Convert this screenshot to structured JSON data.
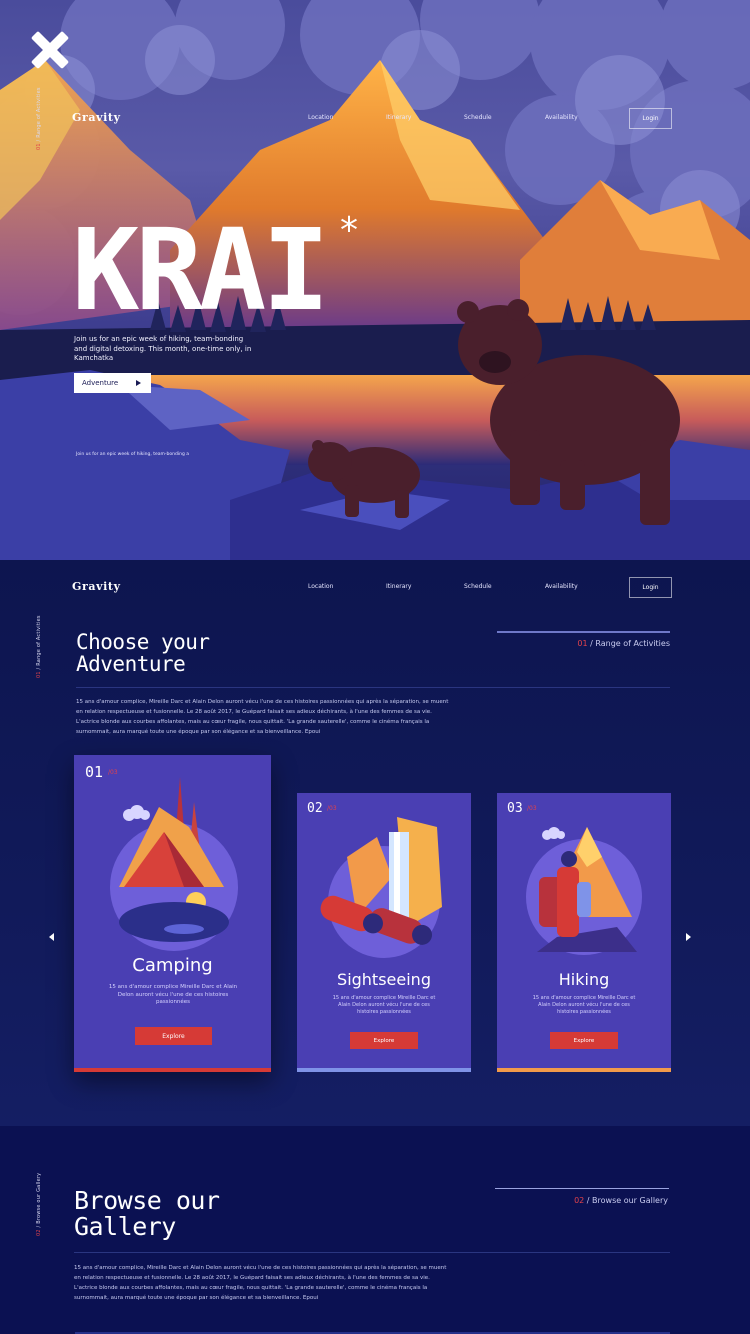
{
  "hero": {
    "brand": "Gravity",
    "nav": [
      "Location",
      "Itinerary",
      "Schedule",
      "Availability"
    ],
    "login": "Login",
    "side_label_num": "01",
    "side_label_text": "/ Range of Activities",
    "title": "KRAI",
    "asterisk": "*",
    "description": "Join us for an epic week of hiking, team-bonding and digital detoxing. This month, one-time only, in Kamchatka",
    "cta": "Adventure",
    "small_caption": "Join us for an epic week of hiking, team-bonding a"
  },
  "section2": {
    "brand": "Gravity",
    "nav": [
      "Location",
      "Itinerary",
      "Schedule",
      "Availability"
    ],
    "login": "Login",
    "side_label_num": "01",
    "side_label_text": "/ Range of Activities",
    "title_line1": "Choose your",
    "title_line2": "Adventure",
    "tag_num": "01",
    "tag_text": "/ Range of Activities",
    "paragraph": "15 ans d'amour complice, Mireille Darc et Alain Delon auront vécu l'une de ces histoires passionnées qui après la séparation, se muent en relation respectueuse et fusionnelle. Le 28 août 2017, le Guépard faisait ses adieux déchirants, à l'une des femmes de sa vie. L'actrice blonde aux courbes affolantes, mais au cœur fragile, nous quittait. 'La grande sauterelle', comme le cinéma français la surnommait, aura marqué toute une époque par son élégance et sa bienveillance. Epoui",
    "cards": [
      {
        "num": "01",
        "sub": "/03",
        "title": "Camping",
        "desc": "15 ans d'amour complice Mireille Darc et Alain Delon auront vécu l'une de ces histoires passionnées",
        "button": "Explore",
        "bar_color": "#d63a36"
      },
      {
        "num": "02",
        "sub": "/03",
        "title": "Sightseeing",
        "desc": "15 ans d'amour complice Mireille Darc et Alain Delon auront vécu l'une de ces histoires passionnées",
        "button": "Explore",
        "bar_color": "#7f93e8"
      },
      {
        "num": "03",
        "sub": "/03",
        "title": "Hiking",
        "desc": "15 ans d'amour complice Mireille Darc et Alain Delon auront vécu l'une de ces histoires passionnées",
        "button": "Explore",
        "bar_color": "#f29a4a"
      }
    ]
  },
  "section3": {
    "side_label_num": "02",
    "side_label_text": "/ Browse our Gallery",
    "title_line1": "Browse our",
    "title_line2": "Gallery",
    "tag_num": "02",
    "tag_text": "/ Browse our Gallery",
    "paragraph": "15 ans d'amour complice, Mireille Darc et Alain Delon auront vécu l'une de ces histoires passionnées qui après la séparation, se muent en relation respectueuse et fusionnelle. Le 28 août 2017, le Guépard faisait ses adieux déchirants, à l'une des femmes de sa vie. L'actrice blonde aux courbes affolantes, mais au cœur fragile, nous quittait. 'La grande sauterelle', comme le cinéma français la surnommait, aura marqué toute une époque par son élégance et sa bienveillance. Epoui"
  },
  "icons": [
    "close-icon",
    "arrow-right-icon",
    "chevron-left-icon",
    "chevron-right-icon"
  ],
  "colors": {
    "background": "#0b1350",
    "card": "#4a3fb3",
    "accent_red": "#d63a36",
    "accent_orange": "#f29a4a"
  }
}
